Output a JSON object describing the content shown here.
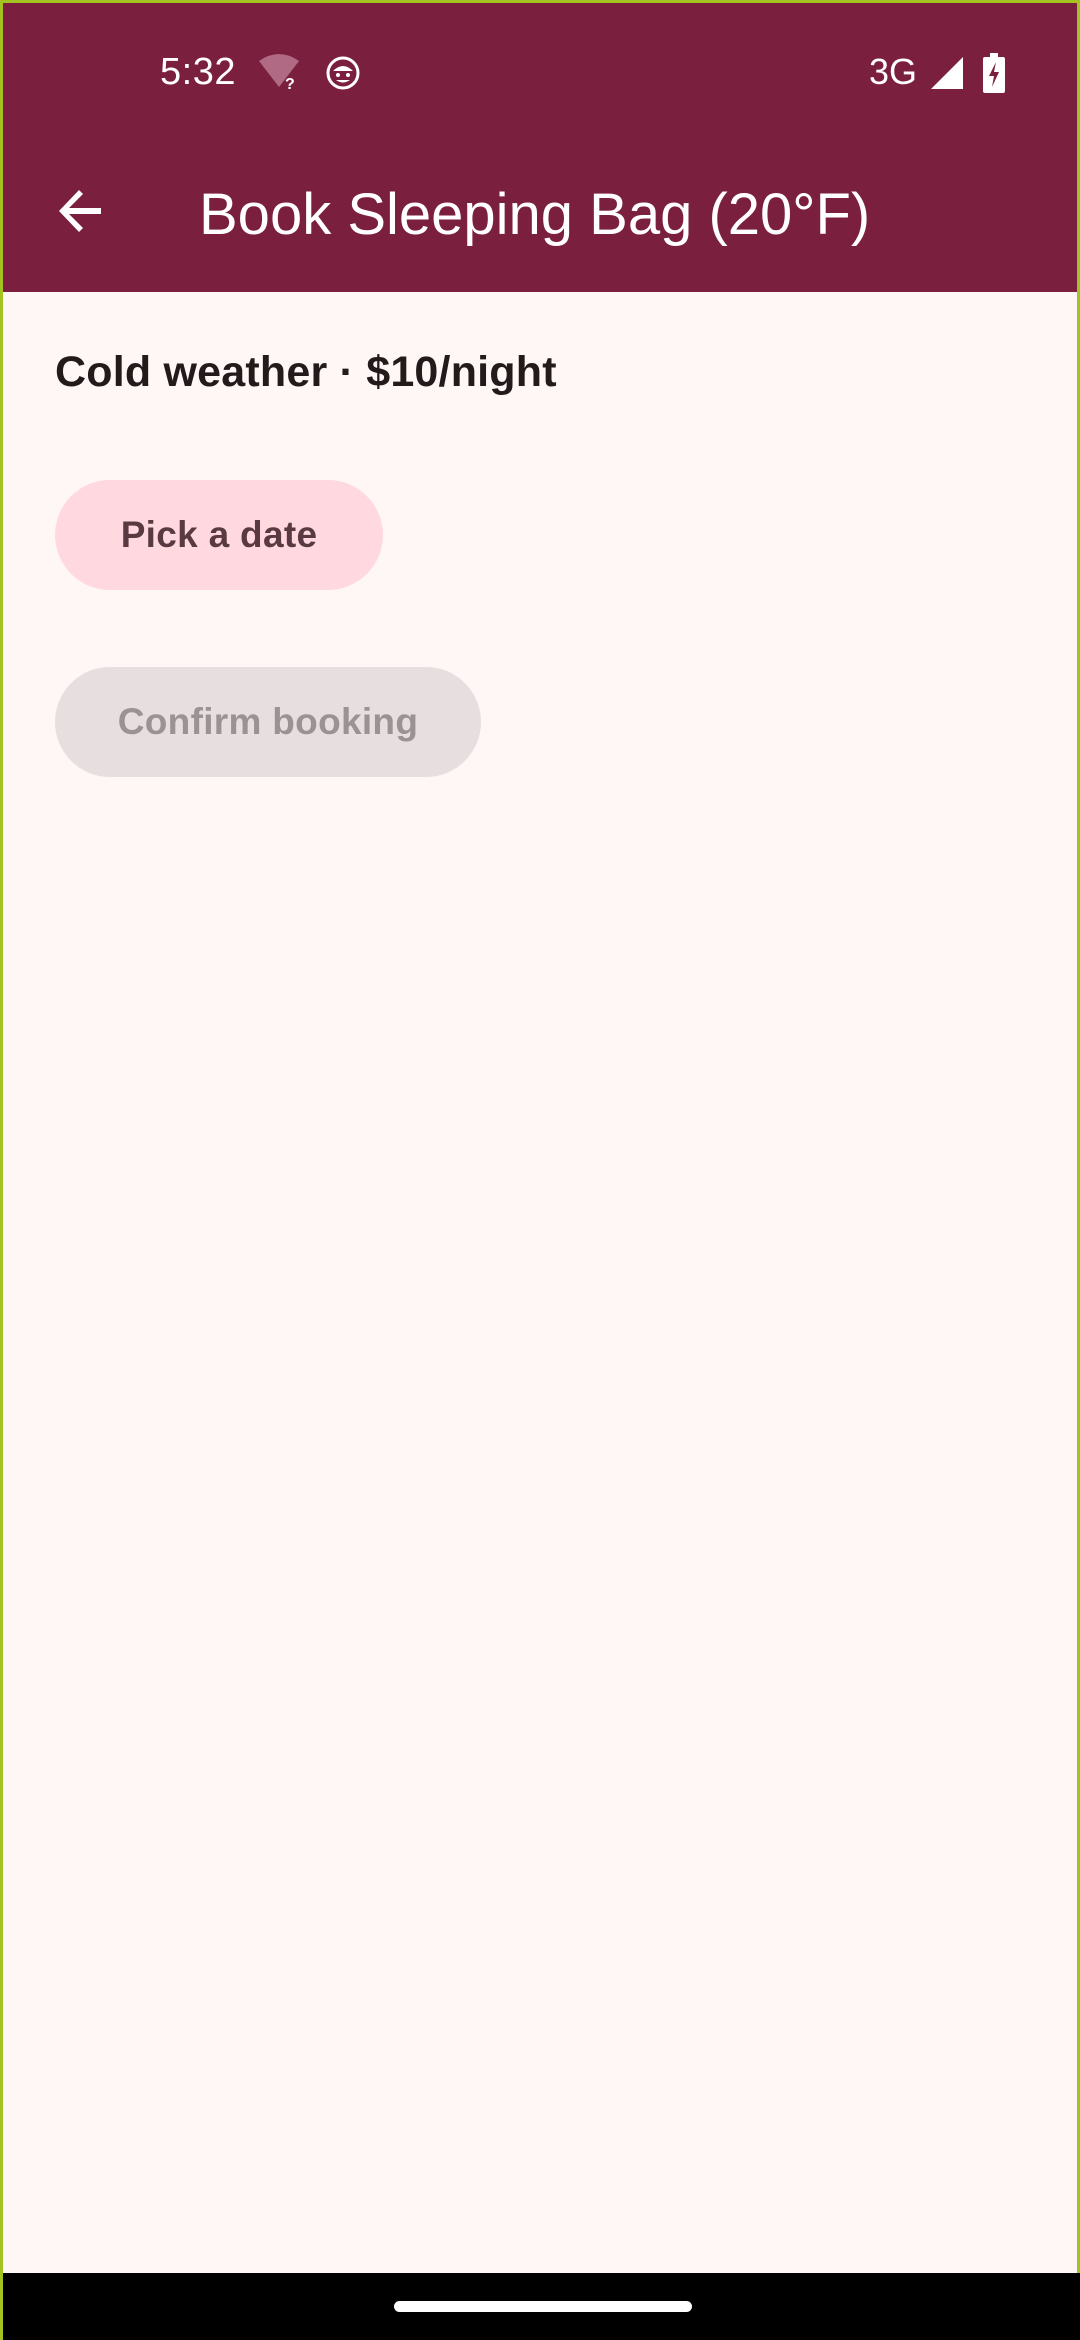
{
  "status_bar": {
    "time": "5:32",
    "network": "3G",
    "icons": [
      "wifi-question-icon",
      "face-icon",
      "signal-icon",
      "battery-charging-icon"
    ]
  },
  "app_bar": {
    "title": "Book Sleeping Bag (20°F)",
    "back_icon": "arrow-back-icon"
  },
  "main": {
    "subtitle": "Cold weather · $10/night",
    "pick_date_label": "Pick a date",
    "confirm_label": "Confirm booking",
    "confirm_enabled": false
  },
  "colors": {
    "primary": "#7b1f3f",
    "background": "#fff7f5",
    "tonal_button": "#ffd9df",
    "disabled_button": "#e6dedf"
  }
}
